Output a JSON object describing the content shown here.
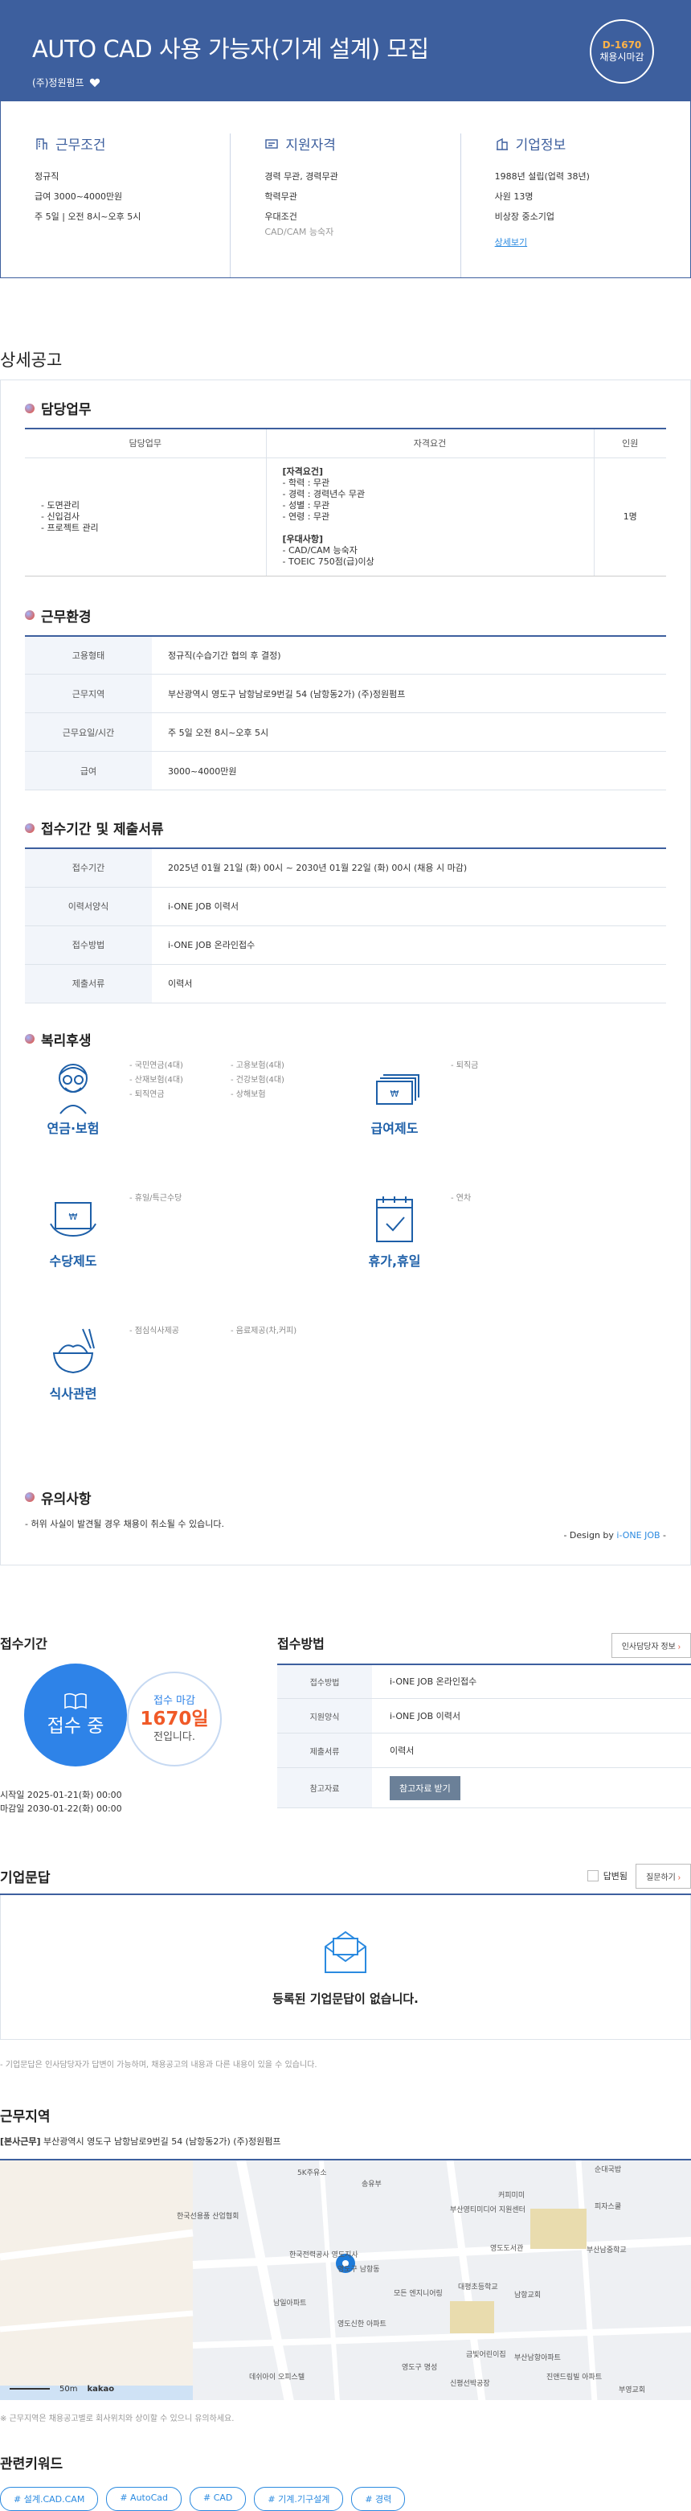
{
  "hero": {
    "title": "AUTO CAD 사용 가능자(기계 설계) 모집",
    "company": "(주)정원펌프",
    "badge_dday": "D-1670",
    "badge_text": "채용시마감"
  },
  "summary": {
    "conditions": {
      "title": "근무조건",
      "lines": [
        "정규직",
        "급여 3000~4000만원",
        "주 5일 | 오전 8시~오후 5시"
      ]
    },
    "qualifications": {
      "title": "지원자격",
      "lines": [
        "경력 무관, 경력무관",
        "학력무관",
        "우대조건"
      ],
      "sub": "CAD/CAM 능숙자"
    },
    "company": {
      "title": "기업정보",
      "lines": [
        "1988년 설립(업력 38년)",
        "사원 13명",
        "비상장 중소기업"
      ],
      "link": "상세보기"
    }
  },
  "detail_title": "상세공고",
  "duty": {
    "title": "담당업무",
    "headers": [
      "담당업무",
      "자격요건",
      "인원"
    ],
    "tasks": [
      "- 도면관리",
      "- 신입검사",
      "- 프로젝트 관리"
    ],
    "req_head1": "[자격요건]",
    "req1": [
      "- 학력 : 무관",
      "- 경력 : 경력년수 무관",
      "- 성별 : 무관",
      "- 연령 : 무관"
    ],
    "req_head2": "[우대사항]",
    "req2": [
      "- CAD/CAM 능숙자",
      "- TOEIC 750점(급)이상"
    ],
    "count": "1명"
  },
  "env": {
    "title": "근무환경",
    "rows": [
      {
        "k": "고용형태",
        "v": "정규직(수습기간 협의 후 결정)"
      },
      {
        "k": "근무지역",
        "v": "부산광역시 영도구 남항남로9번길 54 (남항동2가) (주)정원펌프"
      },
      {
        "k": "근무요일/시간",
        "v": "주 5일 오전 8시~오후 5시"
      },
      {
        "k": "급여",
        "v": "3000~4000만원"
      }
    ]
  },
  "period": {
    "title": "접수기간 및 제출서류",
    "rows": [
      {
        "k": "접수기간",
        "v": "2025년 01월 21일 (화) 00시 ~ 2030년 01월 22일 (화) 00시 (채용 시 마감)"
      },
      {
        "k": "이력서양식",
        "v": "i-ONE JOB 이력서"
      },
      {
        "k": "접수방법",
        "v": "i-ONE JOB 온라인접수"
      },
      {
        "k": "제출서류",
        "v": "이력서"
      }
    ]
  },
  "benefits": {
    "title": "복리후생",
    "pension": {
      "label": "연금·보험",
      "col1": [
        "- 국민연금(4대)",
        "- 산재보험(4대)",
        "- 퇴직연금"
      ],
      "col2": [
        "- 고용보험(4대)",
        "- 건강보험(4대)",
        "- 상해보험"
      ]
    },
    "salary": {
      "label": "급여제도",
      "items": [
        "- 퇴직금"
      ]
    },
    "allowance": {
      "label": "수당제도",
      "items": [
        "- 휴일/특근수당"
      ]
    },
    "holiday": {
      "label": "휴가,휴일",
      "items": [
        "- 연차"
      ]
    },
    "meal": {
      "label": "식사관련",
      "col1": [
        "- 점심식사제공"
      ],
      "col2": [
        "- 음료제공(차,커피)"
      ]
    }
  },
  "caution": {
    "title": "유의사항",
    "text": "- 허위 사실이 발견될 경우 채용이 취소될 수 있습니다.",
    "design_prefix": "- Design by ",
    "design_brand": "i-ONE JOB",
    "design_suffix": " -"
  },
  "receive": {
    "title": "접수기간",
    "status": "접수 중",
    "deadline_label": "접수 마감",
    "deadline_days": "1670일",
    "deadline_suffix": "전입니다.",
    "start": "시작일 2025-01-21(화) 00:00",
    "end": "마감일 2030-01-22(화) 00:00"
  },
  "apply": {
    "title": "접수방법",
    "contact_btn": "인사담당자 정보",
    "rows": [
      {
        "k": "접수방법",
        "v": "i-ONE JOB 온라인접수"
      },
      {
        "k": "지원양식",
        "v": "i-ONE JOB 이력서"
      },
      {
        "k": "제출서류",
        "v": "이력서"
      }
    ],
    "ref_key": "참고자료",
    "ref_btn": "참고자료 받기"
  },
  "qa": {
    "title": "기업문답",
    "check_label": "답변됨",
    "ask_btn": "질문하기",
    "empty": "등록된 기업문답이 없습니다.",
    "note": "- 기업문답은 인사담당자가 답변이 가능하며, 채용공고의 내용과 다른 내용이 있을 수 있습니다."
  },
  "location": {
    "title": "근무지역",
    "tag": "[본사근무]",
    "address": "부산광역시 영도구 남항남로9번길 54 (남항동2가) (주)정원펌프",
    "map_labels": [
      "5K주유소",
      "송유부",
      "순대국밥",
      "커피미미",
      "피자스쿨",
      "부산영티미디어 지원센터",
      "한국선용품 산업협회",
      "한국전력공사 영도지사",
      "영도구 남항동",
      "영도도서관",
      "대평초등학교",
      "남항교회",
      "부산남중학교",
      "남일아파트",
      "모든 엔지니어링",
      "영도신한 아파트",
      "금빛어린이집",
      "영도구 명성",
      "부산남항아파트",
      "데쉬아이 오피스텔",
      "신평선박공장",
      "진앤드림빌 아파트",
      "부영교회"
    ],
    "scale": "50m",
    "kakao": "kakao",
    "note": "※ 근무지역은 채용공고별로 회사위치와 상이할 수 있으니 유의하세요."
  },
  "keywords": {
    "title": "관련키워드",
    "tags": [
      "# 설계.CAD.CAM",
      "# AutoCad",
      "# CAD",
      "# 기계.기구설계",
      "# 경력"
    ]
  }
}
